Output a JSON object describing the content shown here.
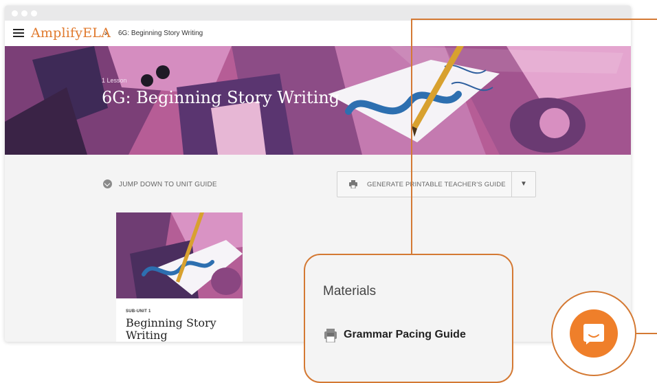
{
  "brand": {
    "name": "AmplifyELA"
  },
  "breadcrumb": {
    "separator": "›",
    "current": "6G: Beginning Story Writing"
  },
  "hero": {
    "kicker": "1 Lesson",
    "title": "6G: Beginning Story Writing"
  },
  "actions": {
    "jump_label": "JUMP DOWN TO UNIT GUIDE",
    "generate_label": "GENERATE PRINTABLE TEACHER'S GUIDE",
    "generate_caret": "▼"
  },
  "card": {
    "kicker": "SUB-UNIT 1",
    "title": "Beginning Story Writing"
  },
  "materials": {
    "title": "Materials",
    "link_label": "Grammar Pacing Guide",
    "link_icon": "pdf-icon"
  },
  "chat": {
    "icon": "chat-bubble-icon"
  },
  "colors": {
    "accent": "#d47933",
    "brand": "#e07a2e",
    "hero_pink": "#c36aa3",
    "chat": "#ef7f2a"
  }
}
